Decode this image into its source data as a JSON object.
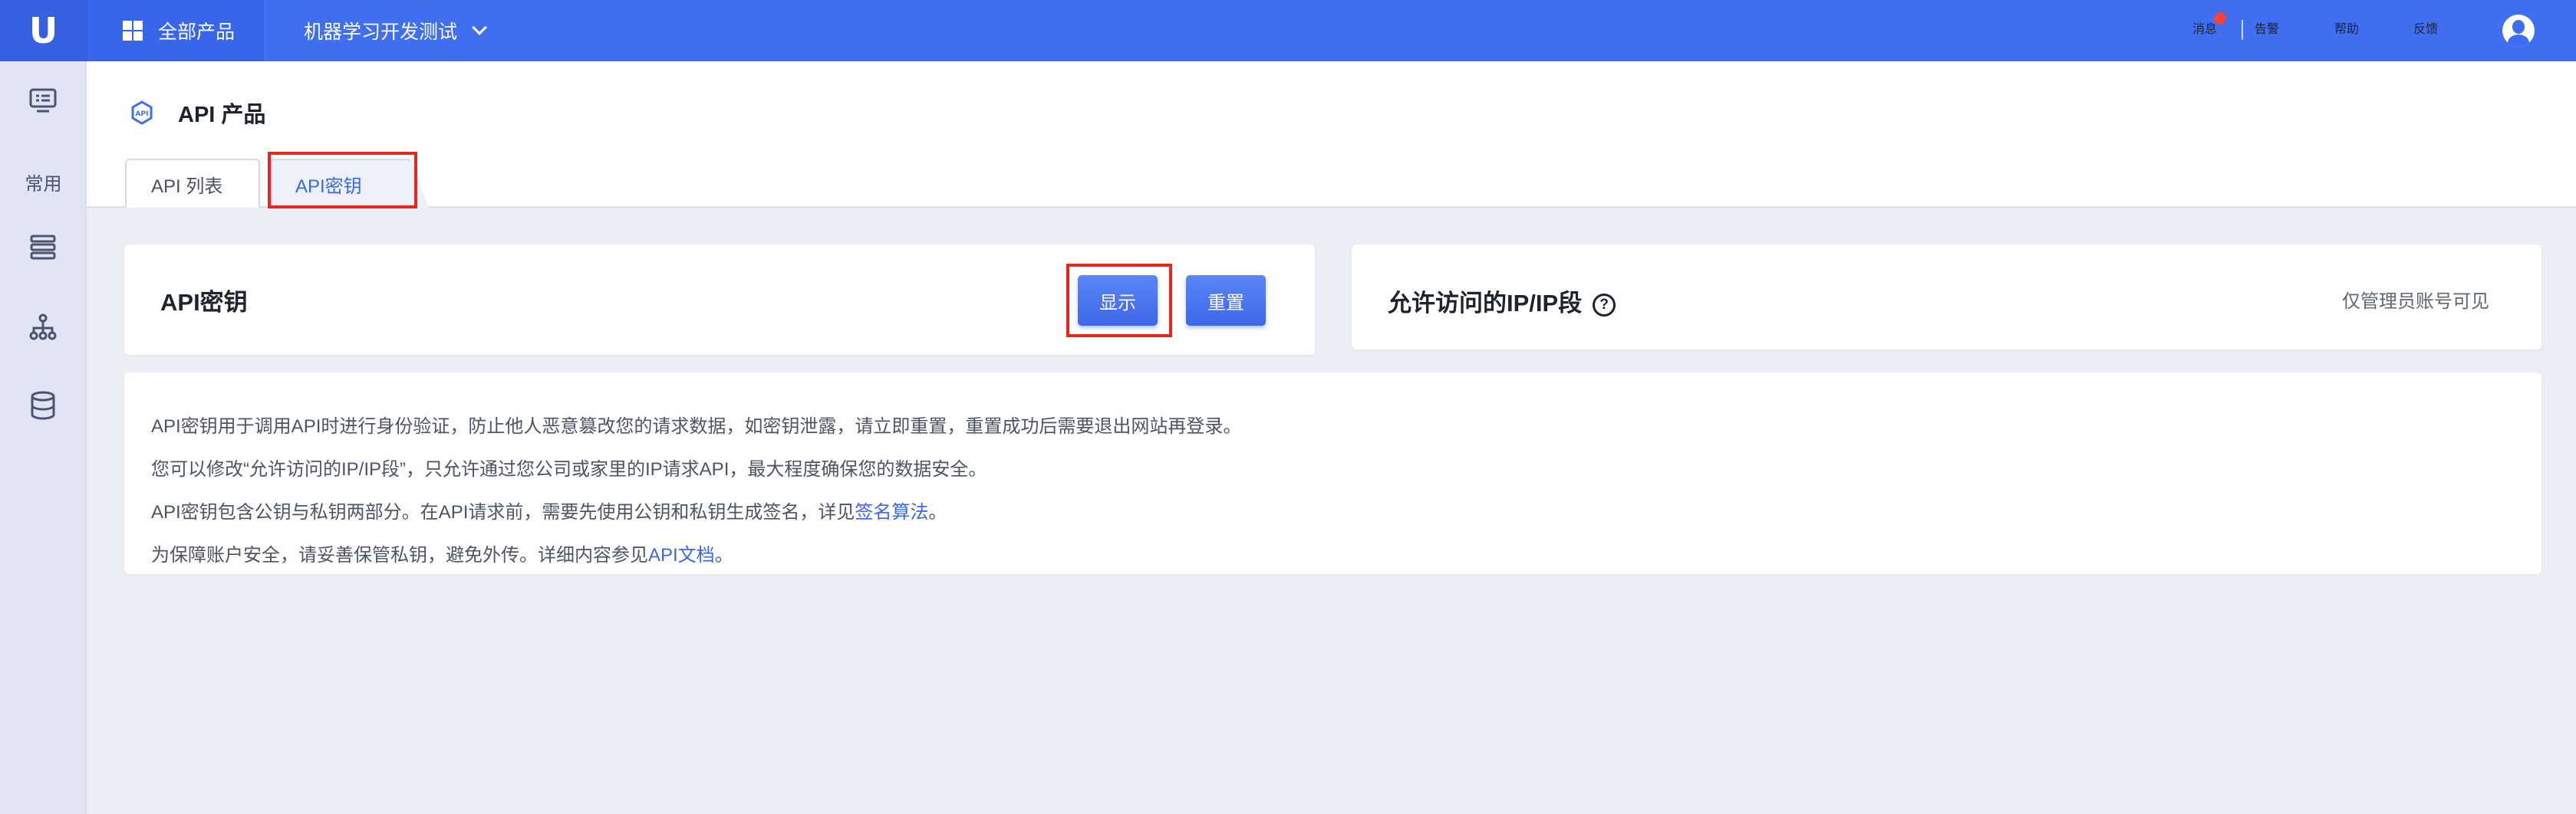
{
  "topbar": {
    "logo": "U",
    "all_products": "全部产品",
    "project": "机器学习开发测试",
    "messages": "消息",
    "alarm": "告警",
    "help": "帮助",
    "feedback": "反馈"
  },
  "sidebar": {
    "common_label": "常用",
    "icons": [
      "monitor-icon",
      "layers-icon",
      "org-chart-icon",
      "database-icon"
    ]
  },
  "page": {
    "title": "API 产品",
    "tabs": [
      {
        "label": "API 列表",
        "active": false
      },
      {
        "label": "API密钥",
        "active": true
      }
    ]
  },
  "key_card": {
    "title": "API密钥",
    "show_button": "显示",
    "reset_button": "重置"
  },
  "ip_card": {
    "title": "允许访问的IP/IP段",
    "help_glyph": "?",
    "note": "仅管理员账号可见"
  },
  "description": {
    "line1": "API密钥用于调用API时进行身份验证，防止他人恶意篡改您的请求数据，如密钥泄露，请立即重置，重置成功后需要退出网站再登录。",
    "line2": "您可以修改“允许访问的IP/IP段”，只允许通过您公司或家里的IP请求API，最大程度确保您的数据安全。",
    "line3_prefix": "API密钥包含公钥与私钥两部分。在API请求前，需要先使用公钥和私钥生成签名，详见",
    "line3_link": "签名算法",
    "line3_suffix": "。",
    "line4_prefix": "为保障账户安全，请妥善保管私钥，避免外传。详细内容参见",
    "line4_link": "API文档",
    "line4_suffix": "。"
  },
  "colors": {
    "brand": "#3f6ef0",
    "highlight_frame": "#e8251f",
    "link": "#3a67e8"
  }
}
